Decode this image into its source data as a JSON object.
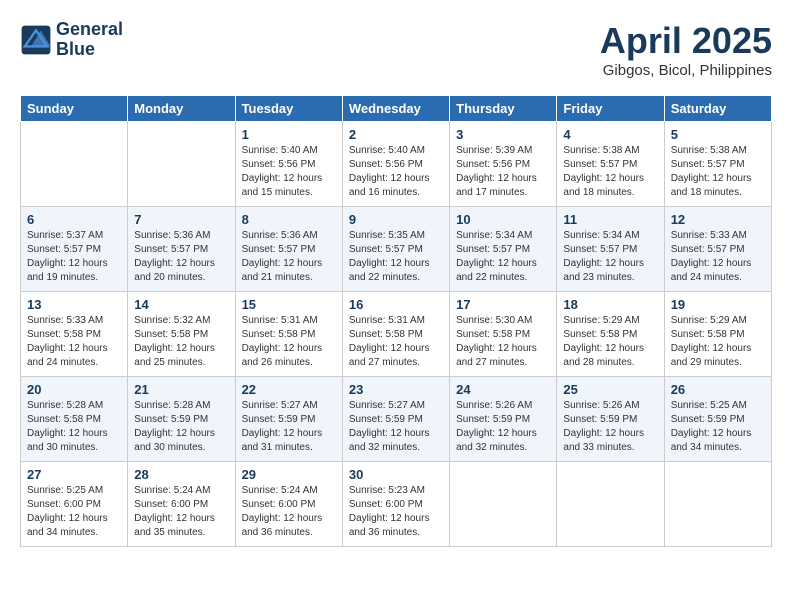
{
  "header": {
    "logo_line1": "General",
    "logo_line2": "Blue",
    "title": "April 2025",
    "subtitle": "Gibgos, Bicol, Philippines"
  },
  "days_of_week": [
    "Sunday",
    "Monday",
    "Tuesday",
    "Wednesday",
    "Thursday",
    "Friday",
    "Saturday"
  ],
  "weeks": [
    [
      {
        "day": "",
        "sunrise": "",
        "sunset": "",
        "daylight": ""
      },
      {
        "day": "",
        "sunrise": "",
        "sunset": "",
        "daylight": ""
      },
      {
        "day": "1",
        "sunrise": "Sunrise: 5:40 AM",
        "sunset": "Sunset: 5:56 PM",
        "daylight": "Daylight: 12 hours and 15 minutes."
      },
      {
        "day": "2",
        "sunrise": "Sunrise: 5:40 AM",
        "sunset": "Sunset: 5:56 PM",
        "daylight": "Daylight: 12 hours and 16 minutes."
      },
      {
        "day": "3",
        "sunrise": "Sunrise: 5:39 AM",
        "sunset": "Sunset: 5:56 PM",
        "daylight": "Daylight: 12 hours and 17 minutes."
      },
      {
        "day": "4",
        "sunrise": "Sunrise: 5:38 AM",
        "sunset": "Sunset: 5:57 PM",
        "daylight": "Daylight: 12 hours and 18 minutes."
      },
      {
        "day": "5",
        "sunrise": "Sunrise: 5:38 AM",
        "sunset": "Sunset: 5:57 PM",
        "daylight": "Daylight: 12 hours and 18 minutes."
      }
    ],
    [
      {
        "day": "6",
        "sunrise": "Sunrise: 5:37 AM",
        "sunset": "Sunset: 5:57 PM",
        "daylight": "Daylight: 12 hours and 19 minutes."
      },
      {
        "day": "7",
        "sunrise": "Sunrise: 5:36 AM",
        "sunset": "Sunset: 5:57 PM",
        "daylight": "Daylight: 12 hours and 20 minutes."
      },
      {
        "day": "8",
        "sunrise": "Sunrise: 5:36 AM",
        "sunset": "Sunset: 5:57 PM",
        "daylight": "Daylight: 12 hours and 21 minutes."
      },
      {
        "day": "9",
        "sunrise": "Sunrise: 5:35 AM",
        "sunset": "Sunset: 5:57 PM",
        "daylight": "Daylight: 12 hours and 22 minutes."
      },
      {
        "day": "10",
        "sunrise": "Sunrise: 5:34 AM",
        "sunset": "Sunset: 5:57 PM",
        "daylight": "Daylight: 12 hours and 22 minutes."
      },
      {
        "day": "11",
        "sunrise": "Sunrise: 5:34 AM",
        "sunset": "Sunset: 5:57 PM",
        "daylight": "Daylight: 12 hours and 23 minutes."
      },
      {
        "day": "12",
        "sunrise": "Sunrise: 5:33 AM",
        "sunset": "Sunset: 5:57 PM",
        "daylight": "Daylight: 12 hours and 24 minutes."
      }
    ],
    [
      {
        "day": "13",
        "sunrise": "Sunrise: 5:33 AM",
        "sunset": "Sunset: 5:58 PM",
        "daylight": "Daylight: 12 hours and 24 minutes."
      },
      {
        "day": "14",
        "sunrise": "Sunrise: 5:32 AM",
        "sunset": "Sunset: 5:58 PM",
        "daylight": "Daylight: 12 hours and 25 minutes."
      },
      {
        "day": "15",
        "sunrise": "Sunrise: 5:31 AM",
        "sunset": "Sunset: 5:58 PM",
        "daylight": "Daylight: 12 hours and 26 minutes."
      },
      {
        "day": "16",
        "sunrise": "Sunrise: 5:31 AM",
        "sunset": "Sunset: 5:58 PM",
        "daylight": "Daylight: 12 hours and 27 minutes."
      },
      {
        "day": "17",
        "sunrise": "Sunrise: 5:30 AM",
        "sunset": "Sunset: 5:58 PM",
        "daylight": "Daylight: 12 hours and 27 minutes."
      },
      {
        "day": "18",
        "sunrise": "Sunrise: 5:29 AM",
        "sunset": "Sunset: 5:58 PM",
        "daylight": "Daylight: 12 hours and 28 minutes."
      },
      {
        "day": "19",
        "sunrise": "Sunrise: 5:29 AM",
        "sunset": "Sunset: 5:58 PM",
        "daylight": "Daylight: 12 hours and 29 minutes."
      }
    ],
    [
      {
        "day": "20",
        "sunrise": "Sunrise: 5:28 AM",
        "sunset": "Sunset: 5:58 PM",
        "daylight": "Daylight: 12 hours and 30 minutes."
      },
      {
        "day": "21",
        "sunrise": "Sunrise: 5:28 AM",
        "sunset": "Sunset: 5:59 PM",
        "daylight": "Daylight: 12 hours and 30 minutes."
      },
      {
        "day": "22",
        "sunrise": "Sunrise: 5:27 AM",
        "sunset": "Sunset: 5:59 PM",
        "daylight": "Daylight: 12 hours and 31 minutes."
      },
      {
        "day": "23",
        "sunrise": "Sunrise: 5:27 AM",
        "sunset": "Sunset: 5:59 PM",
        "daylight": "Daylight: 12 hours and 32 minutes."
      },
      {
        "day": "24",
        "sunrise": "Sunrise: 5:26 AM",
        "sunset": "Sunset: 5:59 PM",
        "daylight": "Daylight: 12 hours and 32 minutes."
      },
      {
        "day": "25",
        "sunrise": "Sunrise: 5:26 AM",
        "sunset": "Sunset: 5:59 PM",
        "daylight": "Daylight: 12 hours and 33 minutes."
      },
      {
        "day": "26",
        "sunrise": "Sunrise: 5:25 AM",
        "sunset": "Sunset: 5:59 PM",
        "daylight": "Daylight: 12 hours and 34 minutes."
      }
    ],
    [
      {
        "day": "27",
        "sunrise": "Sunrise: 5:25 AM",
        "sunset": "Sunset: 6:00 PM",
        "daylight": "Daylight: 12 hours and 34 minutes."
      },
      {
        "day": "28",
        "sunrise": "Sunrise: 5:24 AM",
        "sunset": "Sunset: 6:00 PM",
        "daylight": "Daylight: 12 hours and 35 minutes."
      },
      {
        "day": "29",
        "sunrise": "Sunrise: 5:24 AM",
        "sunset": "Sunset: 6:00 PM",
        "daylight": "Daylight: 12 hours and 36 minutes."
      },
      {
        "day": "30",
        "sunrise": "Sunrise: 5:23 AM",
        "sunset": "Sunset: 6:00 PM",
        "daylight": "Daylight: 12 hours and 36 minutes."
      },
      {
        "day": "",
        "sunrise": "",
        "sunset": "",
        "daylight": ""
      },
      {
        "day": "",
        "sunrise": "",
        "sunset": "",
        "daylight": ""
      },
      {
        "day": "",
        "sunrise": "",
        "sunset": "",
        "daylight": ""
      }
    ]
  ]
}
